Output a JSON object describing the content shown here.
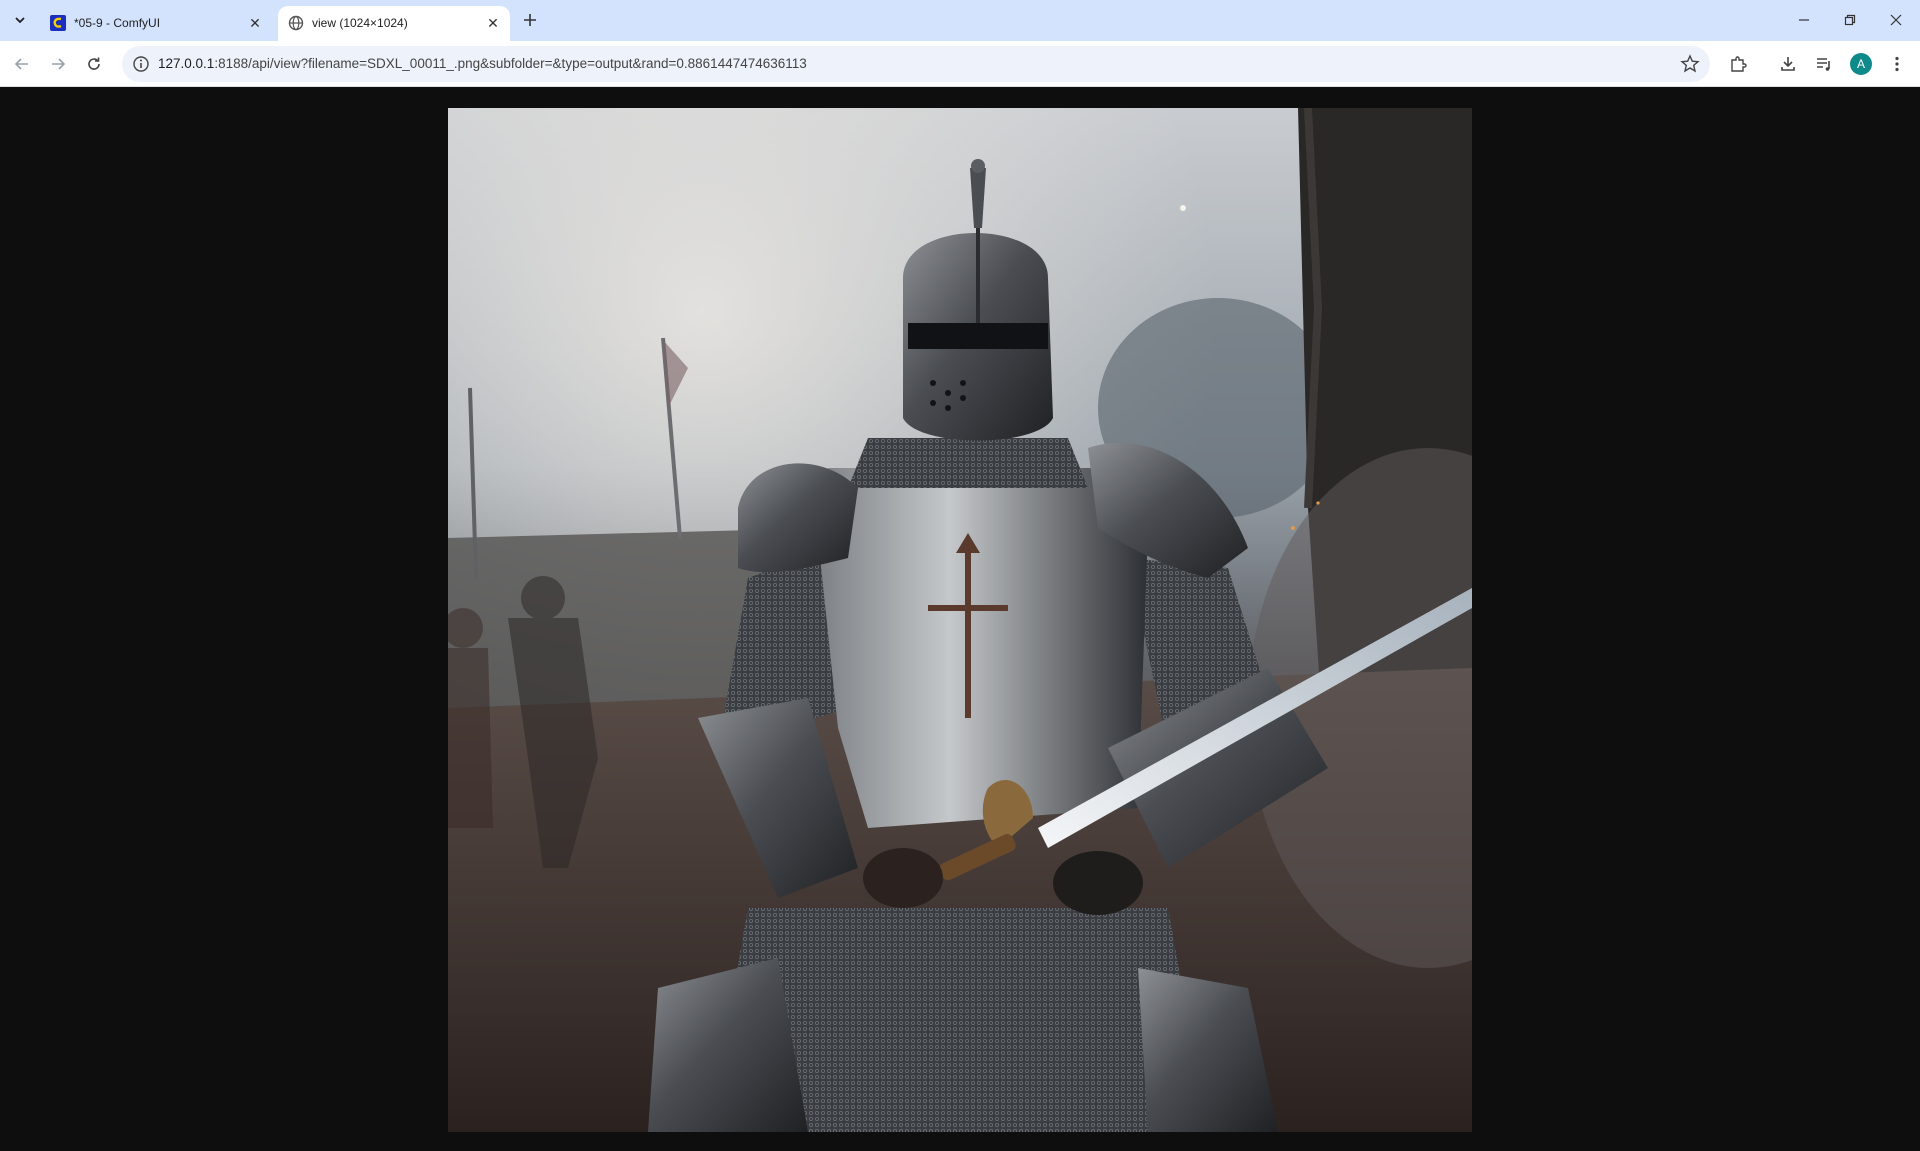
{
  "browser": {
    "tabs": [
      {
        "title": "*05-9 - ComfyUI",
        "active": false,
        "favicon": "comfyui-icon"
      },
      {
        "title": "view (1024×1024)",
        "active": true,
        "favicon": "globe-icon"
      }
    ],
    "address_bar": {
      "host": "127.0.0.1",
      "path": ":8188/api/view?filename=SDXL_00011_.png&subfolder=&type=output&rand=0.8861447474636113"
    },
    "profile_initial": "A"
  },
  "colors": {
    "tabstrip_bg": "#d3e3fd",
    "omnibox_bg": "#eef3fb",
    "viewer_bg": "#0e0e0e",
    "avatar": "#0f8a8a"
  },
  "image": {
    "subject": "armored knight holding a sword"
  }
}
